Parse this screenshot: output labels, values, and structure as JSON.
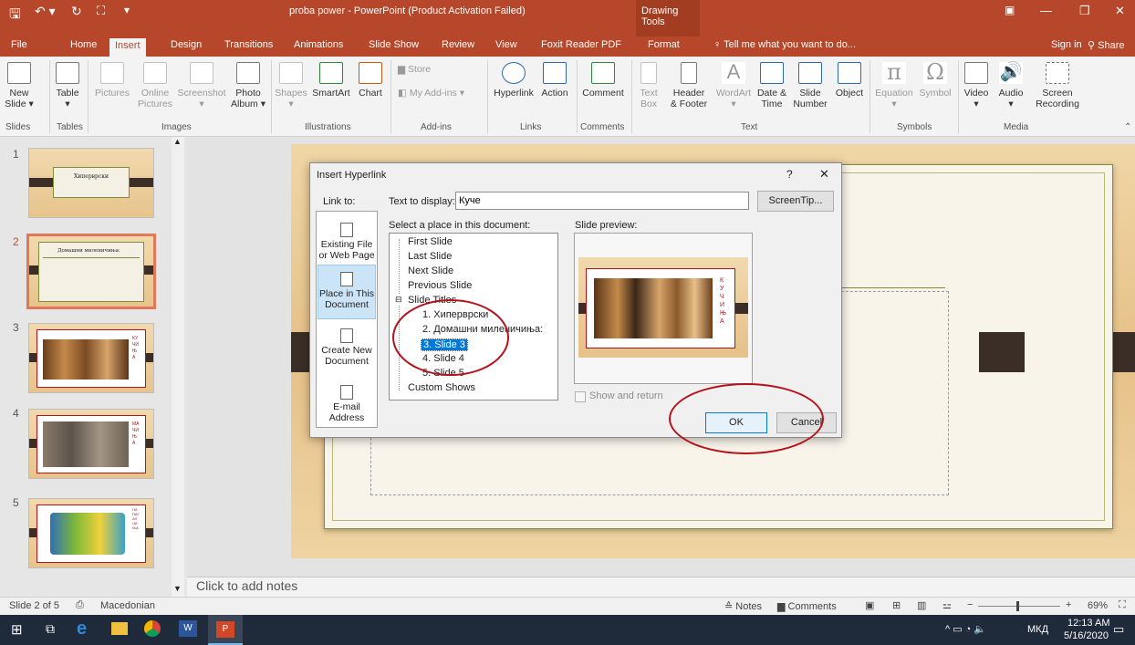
{
  "titlebar": {
    "title": "proba power - PowerPoint (Product Activation Failed)",
    "context_label": "Drawing Tools",
    "colors": {
      "accent": "#b7472a"
    }
  },
  "tabs": [
    "File",
    "Home",
    "Insert",
    "Design",
    "Transitions",
    "Animations",
    "Slide Show",
    "Review",
    "View",
    "Foxit Reader PDF",
    "Format"
  ],
  "active_tab": "Insert",
  "tell_me": "Tell me what you want to do...",
  "sign_in": "Sign in",
  "share": "Share",
  "ribbon": {
    "buttons": [
      {
        "label": "New",
        "label2": "Slide ▾",
        "icon": "new-slide-icon"
      },
      {
        "label": "Table",
        "label2": "▾",
        "icon": "table-icon"
      },
      {
        "label": "Pictures",
        "label2": "",
        "icon": "pictures-icon"
      },
      {
        "label": "Online",
        "label2": "Pictures",
        "icon": "online-pictures-icon"
      },
      {
        "label": "Screenshot",
        "label2": "▾",
        "icon": "screenshot-icon"
      },
      {
        "label": "Photo",
        "label2": "Album ▾",
        "icon": "photo-album-icon"
      },
      {
        "label": "Shapes",
        "label2": "▾",
        "icon": "shapes-icon"
      },
      {
        "label": "SmartArt",
        "label2": "",
        "icon": "smartart-icon"
      },
      {
        "label": "Chart",
        "label2": "",
        "icon": "chart-icon"
      },
      {
        "label": "Store",
        "label2": "",
        "icon": "store-icon"
      },
      {
        "label": "My Add-ins",
        "label2": "▾",
        "icon": "my-addins-icon"
      },
      {
        "label": "Hyperlink",
        "label2": "",
        "icon": "hyperlink-icon"
      },
      {
        "label": "Action",
        "label2": "",
        "icon": "action-icon"
      },
      {
        "label": "Comment",
        "label2": "",
        "icon": "comment-icon"
      },
      {
        "label": "Text",
        "label2": "Box",
        "icon": "textbox-icon"
      },
      {
        "label": "Header",
        "label2": "& Footer",
        "icon": "header-footer-icon"
      },
      {
        "label": "WordArt",
        "label2": "▾",
        "icon": "wordart-icon"
      },
      {
        "label": "Date &",
        "label2": "Time",
        "icon": "date-time-icon"
      },
      {
        "label": "Slide",
        "label2": "Number",
        "icon": "slide-number-icon"
      },
      {
        "label": "Object",
        "label2": "",
        "icon": "object-icon"
      },
      {
        "label": "Equation",
        "label2": "▾",
        "icon": "equation-icon"
      },
      {
        "label": "Symbol",
        "label2": "",
        "icon": "symbol-icon"
      },
      {
        "label": "Video",
        "label2": "▾",
        "icon": "video-icon"
      },
      {
        "label": "Audio",
        "label2": "▾",
        "icon": "audio-icon"
      },
      {
        "label": "Screen",
        "label2": "Recording",
        "icon": "screen-recording-icon"
      }
    ],
    "groups": [
      "Slides",
      "Tables",
      "Images",
      "Illustrations",
      "Add-ins",
      "Links",
      "Comments",
      "Text",
      "Symbols",
      "Media"
    ]
  },
  "thumbnails": {
    "numbers": [
      "1",
      "2",
      "3",
      "4",
      "5"
    ],
    "slide1_title": "Хиперврски",
    "slide2_title": "Домашни миленичиња:",
    "slide3_label": "КУЧИЊА",
    "slide4_label": "МАЧИЊА",
    "slide5_label": "ПАПАГАЛЧИЊА"
  },
  "notes_placeholder": "Click to add notes",
  "status": {
    "slide_of": "Slide 2 of 5",
    "language": "Macedonian",
    "notes": "Notes",
    "comments": "Comments",
    "zoom": "69%"
  },
  "dialog": {
    "title": "Insert Hyperlink",
    "help": "?",
    "close": "✕",
    "link_to": "Link to:",
    "text_to_display_label": "Text to display:",
    "text_to_display_value": "Куче",
    "screentip": "ScreenTip...",
    "select_place": "Select a place in this document:",
    "slide_preview": "Slide preview:",
    "link_options": [
      {
        "line1": "Existing File",
        "line2": "or Web Page"
      },
      {
        "line1": "Place in This",
        "line2": "Document"
      },
      {
        "line1": "Create New",
        "line2": "Document"
      },
      {
        "line1": "E-mail",
        "line2": "Address"
      }
    ],
    "tree": [
      "First Slide",
      "Last Slide",
      "Next Slide",
      "Previous Slide",
      "Slide Titles",
      "1. Хиперврски",
      "2. Домашни миленичиња:",
      "3. Slide 3",
      "4. Slide 4",
      "5. Slide 5",
      "Custom Shows"
    ],
    "selected_item": "3. Slide 3",
    "preview_label": "КУЧИЊА",
    "show_and_return": "Show and return",
    "ok": "OK",
    "cancel": "Cancel"
  },
  "taskbar": {
    "language": "МКД",
    "time": "12:13 AM",
    "date": "5/16/2020"
  }
}
